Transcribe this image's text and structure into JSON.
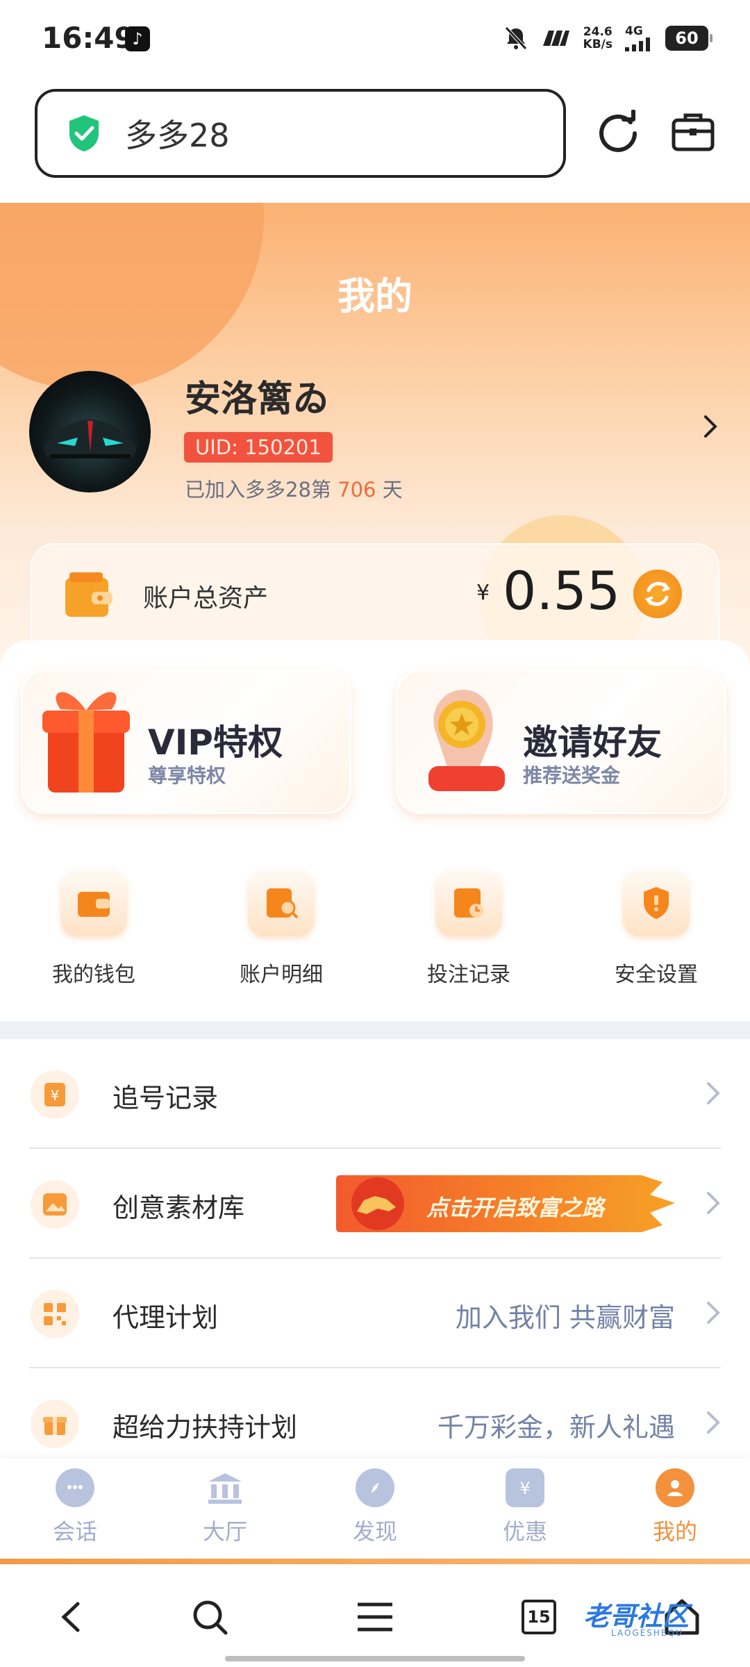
{
  "status_bar": {
    "time": "16:49",
    "network_speed_value": "24.6",
    "network_speed_unit": "KB/s",
    "network_type": "4G",
    "battery": "60"
  },
  "browser": {
    "url_text": "多多28"
  },
  "header": {
    "title": "我的",
    "username": "安洛篱ゐ",
    "uid": "UID: 150201",
    "joined_prefix": "已加入多多28第",
    "joined_days": "706",
    "joined_suffix": "天"
  },
  "assets": {
    "label": "账户总资产",
    "currency": "¥",
    "amount": "0.55"
  },
  "feature_cards": [
    {
      "title": "VIP特权",
      "subtitle": "尊享特权"
    },
    {
      "title": "邀请好友",
      "subtitle": "推荐送奖金"
    }
  ],
  "shortcuts": [
    {
      "label": "我的钱包",
      "icon": "wallet-icon"
    },
    {
      "label": "账户明细",
      "icon": "account-detail-icon"
    },
    {
      "label": "投注记录",
      "icon": "bet-record-icon"
    },
    {
      "label": "安全设置",
      "icon": "security-icon"
    }
  ],
  "menu": [
    {
      "label": "追号记录",
      "right": ""
    },
    {
      "label": "创意素材库",
      "promo": "点击开启致富之路"
    },
    {
      "label": "代理计划",
      "right": "加入我们 共赢财富"
    },
    {
      "label": "超给力扶持计划",
      "right": "千万彩金，新人礼遇"
    }
  ],
  "tabs": [
    {
      "label": "会话",
      "icon": "chat-icon"
    },
    {
      "label": "大厅",
      "icon": "hall-icon"
    },
    {
      "label": "发现",
      "icon": "compass-icon"
    },
    {
      "label": "优惠",
      "icon": "coupon-icon"
    },
    {
      "label": "我的",
      "icon": "profile-icon",
      "active": true
    }
  ],
  "browser_nav": {
    "tab_count": "15"
  },
  "watermark": {
    "text": "老哥社区",
    "sub": "LAOGESHEQU"
  },
  "colors": {
    "accent": "#f0923c",
    "uid_badge": "#f1533f",
    "tab_inactive": "#a3adcb",
    "label_gray": "#7382a6"
  }
}
